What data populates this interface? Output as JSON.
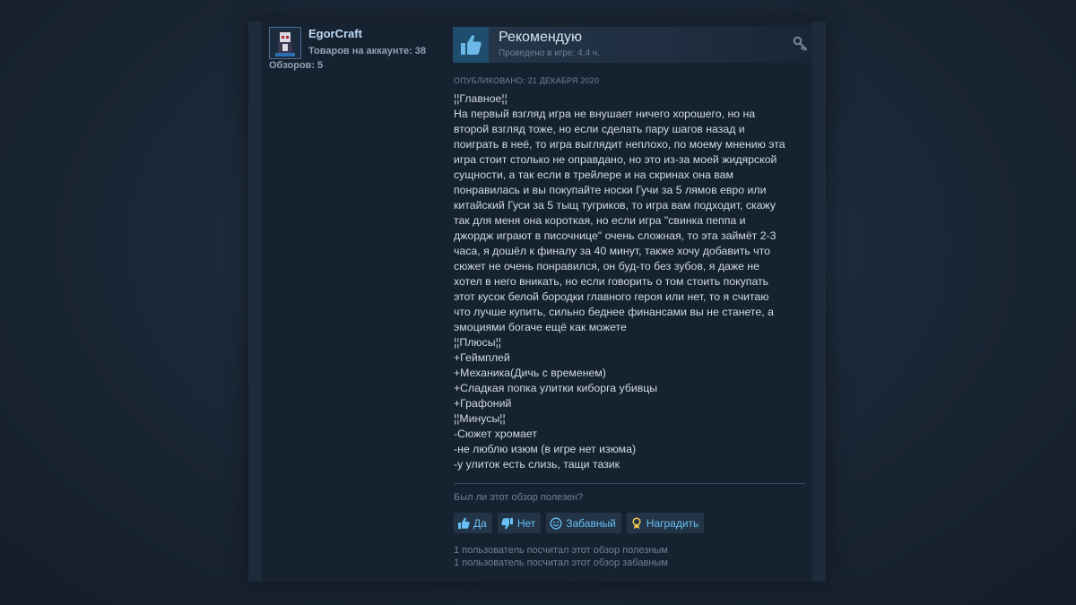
{
  "author": {
    "name": "EgorCraft",
    "products": "Товаров на аккаунте: 38",
    "reviews": "Обзоров: 5"
  },
  "verdict": {
    "title": "Рекомендую",
    "playtime": "Проведено в игре: 4.4 ч."
  },
  "posted": "ОПУБЛИКОВАНО: 21 ДЕКАБРЯ 2020",
  "review_lines": [
    "¦¦Главное¦¦",
    "На первый взгляд игра не внушает ничего хорошего, но на",
    "второй взгляд тоже, но если сделать пару шагов назад и",
    "поиграть в неё, то игра выглядит неплохо, по моему мнению эта",
    "игра стоит столько не оправдано, но это из-за моей жидярской",
    "сущности, а так если в трейлере и на скринах она вам",
    "понравилась и вы покупайте носки Гучи за 5 лямов евро или",
    "китайский Гуси за 5 тыщ тугриков, то игра вам подходит, скажу",
    "так для меня она короткая, но если игра \"свинка пеппа и",
    "джордж играют в писочнице\" очень сложная, то эта займёт 2-3",
    "часа, я дошёл к финалу за 40 минут, также хочу добавить что",
    "сюжет не очень понравился, он буд-то без зубов, я даже не",
    "хотел в него вникать, но если говорить о том стоить покупать",
    "этот кусок белой бородки главного героя или нет, то я считаю",
    "что лучше купить, сильно беднее финансами вы не станете, а",
    "эмоциями богаче ещё как можете",
    "¦¦Плюсы¦¦",
    "+Геймплей",
    "+Механика(Дичь с временем)",
    "+Сладкая попка улитки киборга убивцы",
    "+Графоний",
    "¦¦Минусы¦¦",
    "-Сюжет хромает",
    "-не люблю изюм (в игре нет изюма)",
    "-у улиток есть слизь, тащи тазик"
  ],
  "helpful_question": "Был ли этот обзор полезен?",
  "buttons": {
    "yes": "Да",
    "no": "Нет",
    "funny": "Забавный",
    "award": "Наградить"
  },
  "stats": {
    "helpful": "1 пользователь посчитал этот обзор полезным",
    "funny": "1 пользователь посчитал этот обзор забавным"
  },
  "icons": {
    "thumbs_up": "thumbs-up-icon",
    "thumbs_down": "thumbs-down-icon",
    "funny": "smiley-icon",
    "award": "award-icon",
    "key": "key-icon"
  },
  "colors": {
    "accent": "#67c1f5",
    "verdict_bg": "#1f4d6e"
  }
}
